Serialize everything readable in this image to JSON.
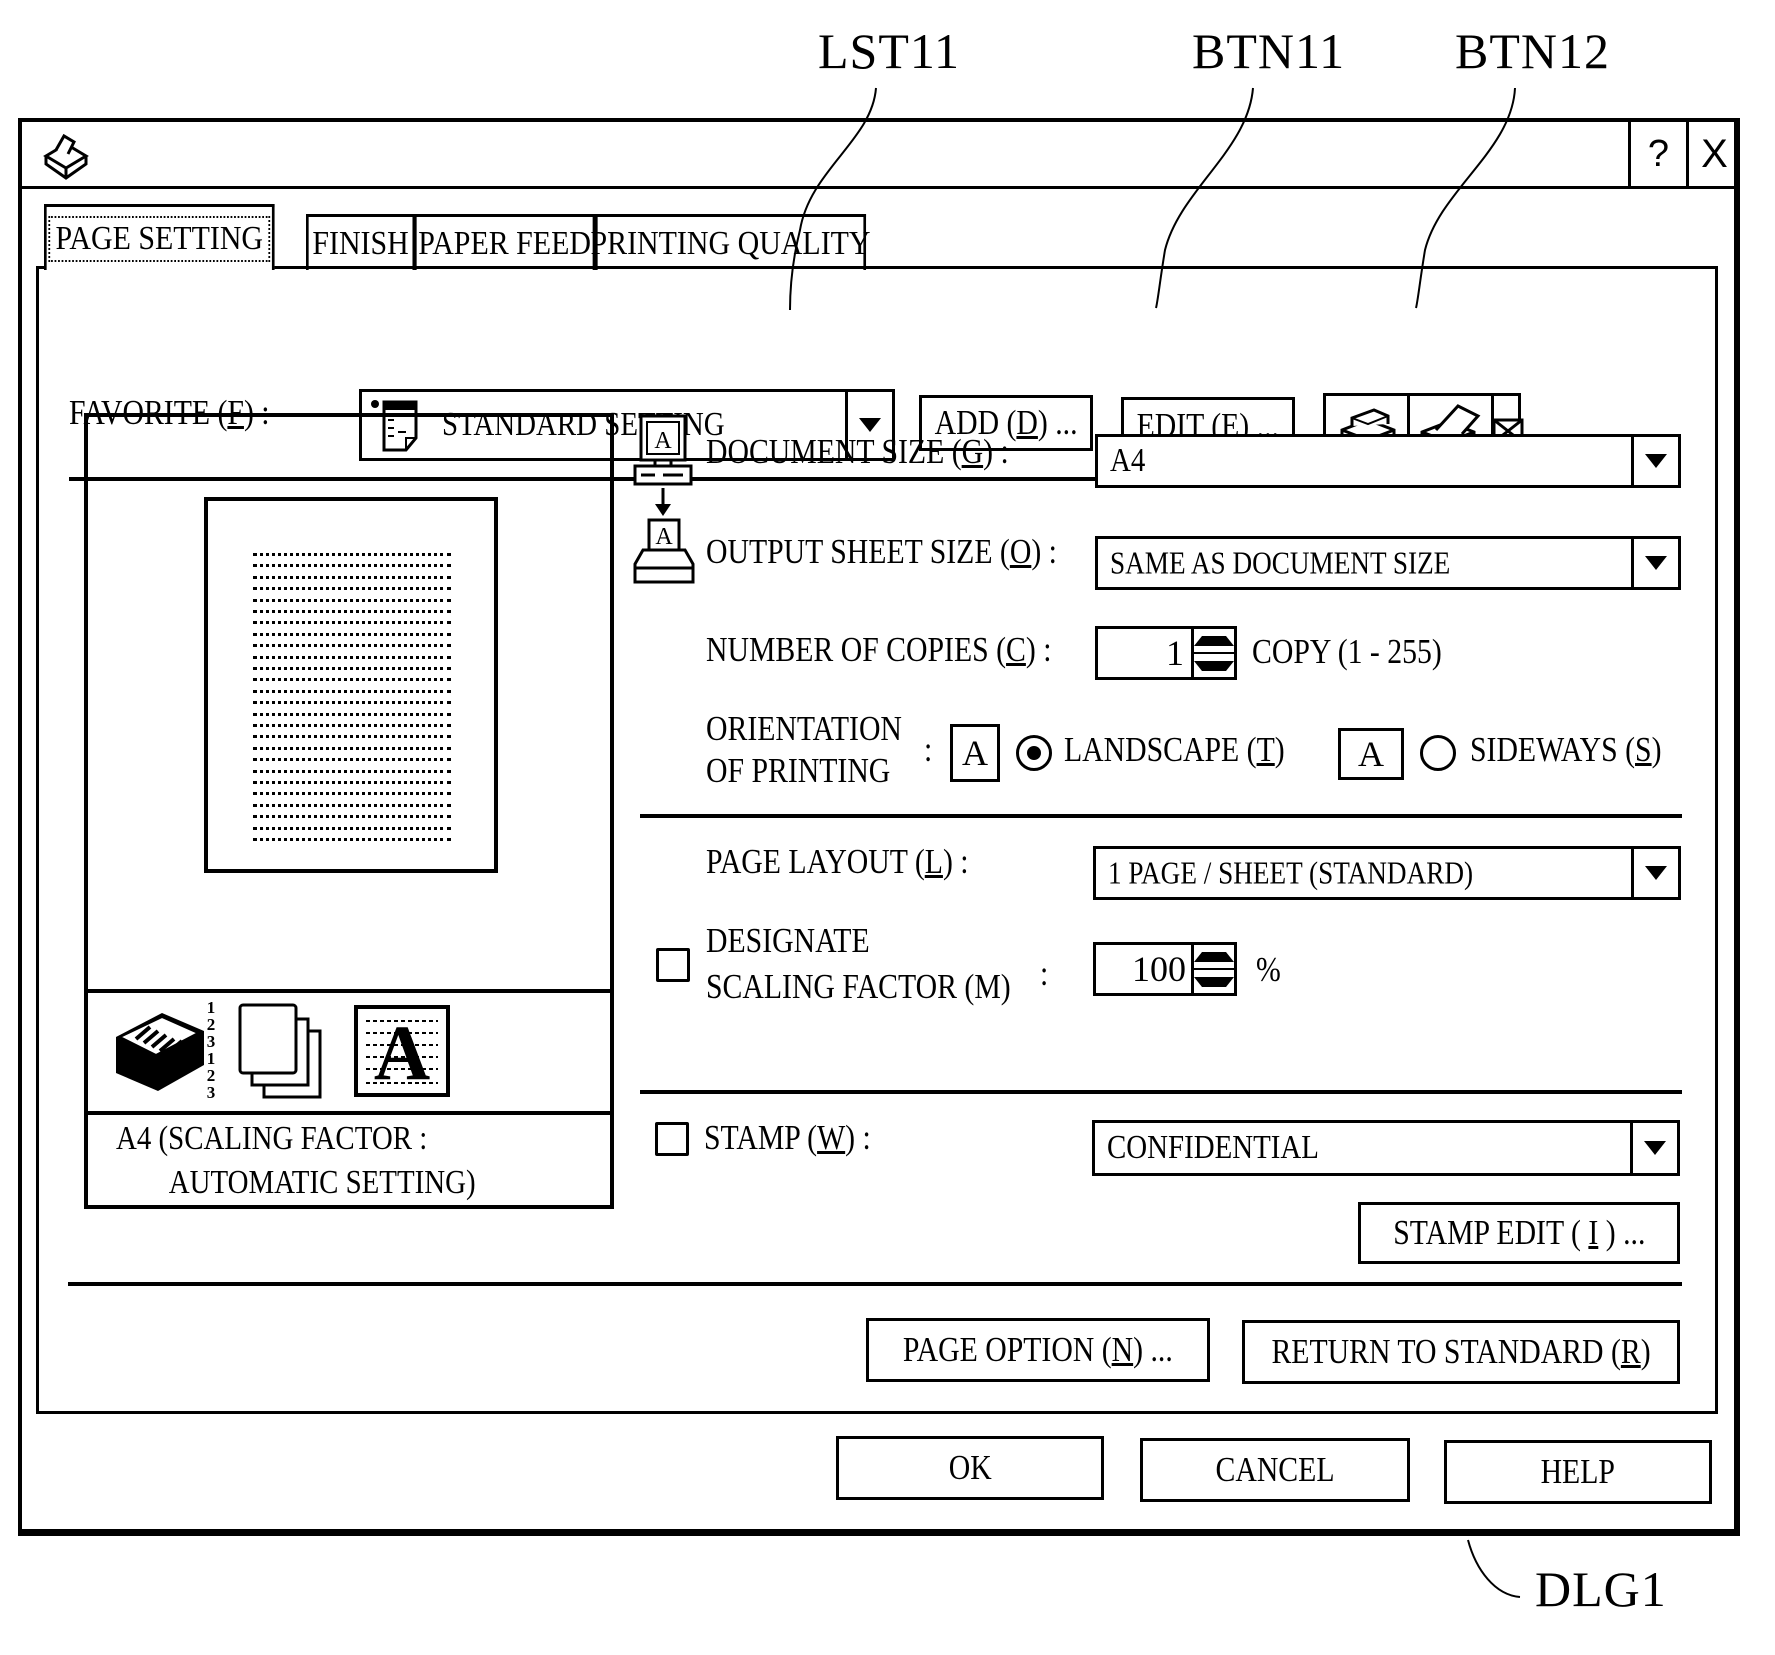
{
  "annotations": {
    "list_ref": "LST11",
    "add_button_ref": "BTN11",
    "edit_button_ref": "BTN12",
    "dialog_ref": "DLG1"
  },
  "titlebar": {
    "app_icon": "printer-icon",
    "help_label": "?",
    "close_label": "X"
  },
  "tabs": [
    {
      "label": "PAGE SETTING",
      "active": true
    },
    {
      "label": "FINISH",
      "active": false
    },
    {
      "label": "PAPER FEED",
      "active": false
    },
    {
      "label": "PRINTING QUALITY",
      "active": false
    }
  ],
  "favorite": {
    "label": "FAVORITE (",
    "mnemonic": "F",
    "label_end": ") :",
    "value": "STANDARD SETTING",
    "value_icon": "document-settings-icon",
    "add_button": {
      "label": "ADD (",
      "mnemonic": "D",
      "label_end": ") ..."
    },
    "edit_button": {
      "label": "EDIT (",
      "mnemonic": "E",
      "label_end": ") ..."
    },
    "view_icons": [
      "printer-front-view-icon",
      "printer-open-view-icon",
      "envelope-icon"
    ]
  },
  "preview": {
    "caption_line1": "A4  (SCALING FACTOR :",
    "caption_line2": "AUTOMATIC SETTING)",
    "collate_numbers": [
      "1",
      "2",
      "3",
      "1",
      "2",
      "3"
    ],
    "strip_icons": [
      "collated-stack-icon",
      "multiple-pages-icon",
      "text-a-icon"
    ]
  },
  "fields": {
    "document_size": {
      "label": "DOCUMENT SIZE (",
      "mnemonic": "G",
      "label_end": ") :",
      "value": "A4"
    },
    "output_sheet_size": {
      "label": "OUTPUT SHEET SIZE (",
      "mnemonic": "O",
      "label_end": ") :",
      "value": "SAME AS DOCUMENT SIZE"
    },
    "copies": {
      "label": "NUMBER OF COPIES (",
      "mnemonic": "C",
      "label_end": ") :",
      "value": "1",
      "unit": "COPY (1 - 255)"
    },
    "orientation": {
      "label_line1": "ORIENTATION",
      "label_line2": "OF PRINTING",
      "colon": ":",
      "options": [
        {
          "label": "LANDSCAPE (",
          "mnemonic": "T",
          "label_end": ")",
          "selected": true,
          "glyph": "A"
        },
        {
          "label": "SIDEWAYS (",
          "mnemonic": "S",
          "label_end": ")",
          "selected": false,
          "glyph": "A"
        }
      ]
    },
    "page_layout": {
      "label": "PAGE LAYOUT (",
      "mnemonic": "L",
      "label_end": ") :",
      "value": "1 PAGE / SHEET (STANDARD)"
    },
    "scaling": {
      "label_line1": "DESIGNATE",
      "label_line2": "SCALING FACTOR (M)",
      "colon": ":",
      "checked": false,
      "value": "100",
      "unit": "%"
    },
    "stamp": {
      "label": "STAMP (",
      "mnemonic": "W",
      "label_end": ") :",
      "checked": false,
      "value": "CONFIDENTIAL"
    },
    "stamp_edit_button": {
      "label": "STAMP EDIT ( ",
      "mnemonic": "I",
      "label_end": " ) ..."
    }
  },
  "panel_buttons": {
    "page_option": {
      "label": "PAGE OPTION (",
      "mnemonic": "N",
      "label_end": ") ..."
    },
    "return_to_standard": {
      "label": "RETURN TO STANDARD (",
      "mnemonic": "R",
      "label_end": ")"
    }
  },
  "dialog_buttons": {
    "ok": "OK",
    "cancel": "CANCEL",
    "help": "HELP"
  }
}
